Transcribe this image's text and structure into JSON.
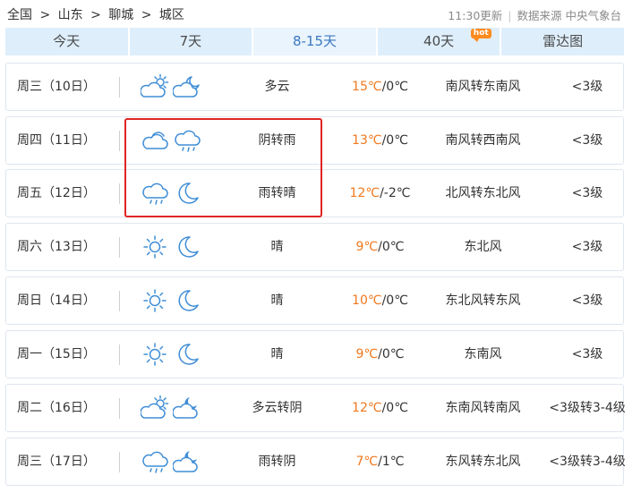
{
  "breadcrumb": [
    "全国",
    ">",
    "山东",
    ">",
    "聊城",
    ">",
    "城区"
  ],
  "meta": {
    "updated": "11:30更新",
    "source": "数据来源 中央气象台"
  },
  "tabs": [
    {
      "label": "今天"
    },
    {
      "label": "7天"
    },
    {
      "label": "8-15天",
      "active": true
    },
    {
      "label": "40天",
      "badge": "hot"
    },
    {
      "label": "雷达图"
    }
  ],
  "days": [
    {
      "day": "周三（10日）",
      "icon1": "partly-cloudy-day-icon",
      "icon2": "partly-cloudy-night-icon",
      "weather": "多云",
      "hi": "15℃",
      "lo": "/0℃",
      "wind": "南风转东南风",
      "level": "<3级"
    },
    {
      "day": "周四（11日）",
      "icon1": "cloudy-icon",
      "icon2": "rain-icon",
      "weather": "阴转雨",
      "hi": "13℃",
      "lo": "/0℃",
      "wind": "南风转西南风",
      "level": "<3级"
    },
    {
      "day": "周五（12日）",
      "icon1": "rain-icon",
      "icon2": "moon-icon",
      "weather": "雨转晴",
      "hi": "12℃",
      "lo": "/-2℃",
      "wind": "北风转东北风",
      "level": "<3级"
    },
    {
      "day": "周六（13日）",
      "icon1": "sun-icon",
      "icon2": "moon-icon",
      "weather": "晴",
      "hi": "9℃",
      "lo": "/0℃",
      "wind": "东北风",
      "level": "<3级"
    },
    {
      "day": "周日（14日）",
      "icon1": "sun-icon",
      "icon2": "moon-icon",
      "weather": "晴",
      "hi": "10℃",
      "lo": "/0℃",
      "wind": "东北风转东风",
      "level": "<3级"
    },
    {
      "day": "周一（15日）",
      "icon1": "sun-icon",
      "icon2": "moon-icon",
      "weather": "晴",
      "hi": "9℃",
      "lo": "/0℃",
      "wind": "东南风",
      "level": "<3级"
    },
    {
      "day": "周二（16日）",
      "icon1": "partly-cloudy-day-icon",
      "icon2": "cloudy-night-icon",
      "weather": "多云转阴",
      "hi": "12℃",
      "lo": "/0℃",
      "wind": "东南风转南风",
      "level": "<3级转3-4级"
    },
    {
      "day": "周三（17日）",
      "icon1": "rain-icon",
      "icon2": "cloudy-night-icon",
      "weather": "雨转阴",
      "hi": "7℃",
      "lo": "/1℃",
      "wind": "东风转东北风",
      "level": "<3级转3-4级"
    }
  ],
  "colors": {
    "accent": "#3f8dd6",
    "temp_high": "#f0781e",
    "tab_bg": "#deeefb",
    "highlight": "#e02424"
  }
}
